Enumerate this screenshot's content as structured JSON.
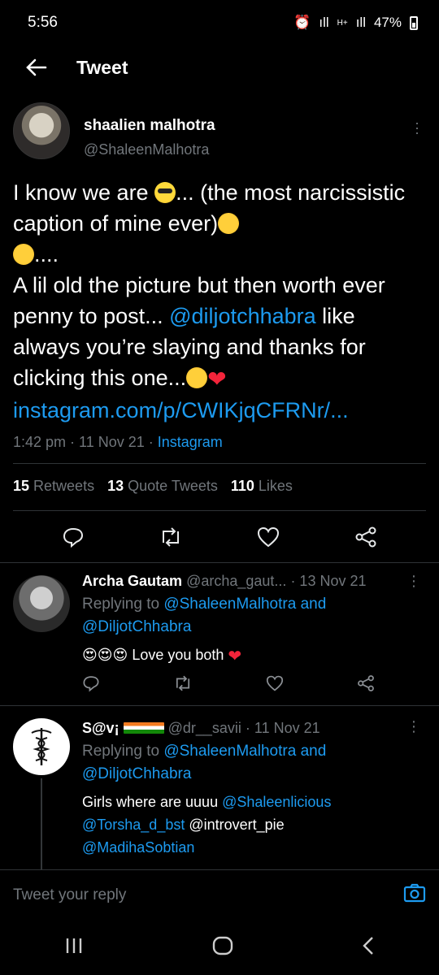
{
  "status_bar": {
    "time": "5:56",
    "battery": "47%",
    "signal": "ıll",
    "network": "H+"
  },
  "header": {
    "title": "Tweet"
  },
  "main_tweet": {
    "author_name": "shaalien malhotra",
    "author_handle": "@ShaleenMalhotra",
    "text_part1": "I know we are ",
    "text_part2": "... (the most narcissistic caption of mine ever)",
    "text_part3": "....",
    "text_part4": "A lil old the picture but then worth ever penny to post... ",
    "mention": "@diljotchhabra",
    "text_part5": " like always you’re slaying and thanks for clicking this one...",
    "link": "instagram.com/p/CWIKjqCFRNr/...",
    "time": "1:42 pm",
    "date": "11 Nov 21",
    "source": "Instagram",
    "retweets_count": "15",
    "retweets_label": "Retweets",
    "quotes_count": "13",
    "quotes_label": "Quote Tweets",
    "likes_count": "110",
    "likes_label": "Likes"
  },
  "replies": [
    {
      "name": "Archa Gautam",
      "handle": "@archa_gaut...",
      "date": "· 13 Nov 21",
      "replying_to": "Replying to",
      "mention_1": "@ShaleenMalhotra",
      "and_word": "and",
      "mention_2": "@DiljotChhabra",
      "text": "Love you both"
    },
    {
      "name": "S@v¡",
      "handle": "@dr__savii",
      "date": "· 11 Nov 21",
      "replying_to": "Replying to",
      "mention_1": "@ShaleenMalhotra",
      "and_word": "and",
      "mention_2": "@DiljotChhabra",
      "text_1": "Girls where are uuuu ",
      "m1": "@Shaleenlicious",
      "m2": "@Torsha_d_bst",
      "text_2": " @introvert_pie",
      "m3": "@MadihaSobtian"
    }
  ],
  "reply_bar": {
    "placeholder": "Tweet your reply"
  },
  "colors": {
    "accent": "#1d9bf0",
    "like": "#f3243a"
  }
}
